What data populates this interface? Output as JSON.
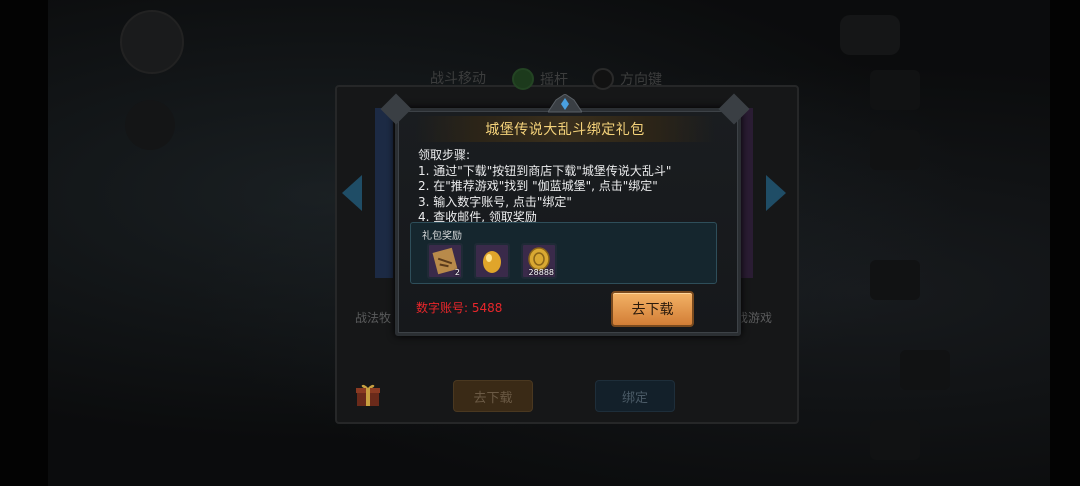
{
  "background": {
    "header": "战斗移动",
    "radio_options": [
      "摇杆",
      "方向键"
    ],
    "left_label": "战法牧",
    "right_label": "戏游戏",
    "buttons": {
      "download": "去下载",
      "bind": "绑定"
    }
  },
  "dialog": {
    "title": "城堡传说大乱斗绑定礼包",
    "steps_heading": "领取步骤:",
    "steps": [
      "1. 通过\"下载\"按钮到商店下载\"城堡传说大乱斗\"",
      "2. 在\"推荐游戏\"找到 \"伽蓝城堡\", 点击\"绑定\"",
      "3. 输入数字账号, 点击\"绑定\"",
      "4. 查收邮件, 领取奖励"
    ],
    "reward_title": "礼包奖励",
    "rewards": [
      {
        "icon": "scroll-icon",
        "qty": "2"
      },
      {
        "icon": "golden-egg-icon",
        "qty": ""
      },
      {
        "icon": "gold-coin-icon",
        "qty": "28888"
      }
    ],
    "account_text": "数字账号: 5488",
    "download_button": "去下载"
  },
  "colors": {
    "title": "#f4d27a",
    "account": "#e8262b",
    "button": "#e59a4e"
  }
}
